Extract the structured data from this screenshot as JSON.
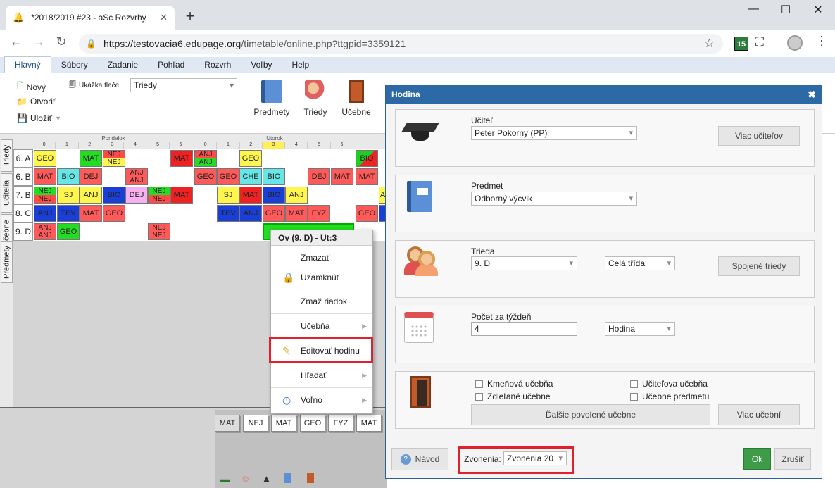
{
  "browser": {
    "tab_title": "*2018/2019 #23 - aSc Rozvrhy",
    "url_host": "https://testovacia6.edupage.org",
    "url_path": "/timetable/online.php?ttgpid=3359121",
    "ext_badge": "15"
  },
  "menu": [
    "Hlavný",
    "Súbory",
    "Zadanie",
    "Pohľad",
    "Rozvrh",
    "Voľby",
    "Help"
  ],
  "ribbon": {
    "new": "Nový",
    "open": "Otvoriť",
    "save": "Uložiť",
    "print_preview": "Ukážka tlače",
    "class_select": "Triedy",
    "big": [
      "Predmety",
      "Triedy",
      "Učebne"
    ]
  },
  "side_tabs": [
    "Triedy",
    "Učitelia",
    "Učebne",
    "Predmety"
  ],
  "timetable": {
    "days": [
      "Pondelok",
      "Utorok"
    ],
    "periods": [
      "0",
      "1",
      "2",
      "3",
      "4",
      "5",
      "6"
    ],
    "rows": [
      "6. A",
      "6. B",
      "7. B",
      "8. C",
      "9. D"
    ]
  },
  "bottom_cards": [
    "MAT",
    "NEJ",
    "MAT",
    "GEO",
    "FYZ",
    "MAT"
  ],
  "context_menu": {
    "header": "Ov (9. D) - Ut:3",
    "items": [
      "Zmazať",
      "Uzamknúť",
      "Zmaž riadok",
      "Učebňa",
      "Editovať hodinu",
      "Hľadať",
      "Voľno"
    ]
  },
  "dialog": {
    "title": "Hodina",
    "teacher_label": "Učiteľ",
    "teacher_value": "Peter Pokorny (PP)",
    "more_teachers": "Viac učiteľov",
    "subject_label": "Predmet",
    "subject_value": "Odborný výcvik",
    "class_label": "Trieda",
    "class_value": "9. D",
    "group_value": "Celá třída",
    "joined_classes": "Spojené triedy",
    "count_label": "Počet za týždeň",
    "count_value": "4",
    "unit_value": "Hodina",
    "checks": [
      "Kmeňová učebňa",
      "Učiteľova učebňa",
      "Zdieľané učebne",
      "Učebne predmetu"
    ],
    "more_rooms_allowed": "Ďalšie povolené učebne",
    "more_rooms": "Viac učební",
    "help": "Návod",
    "bells_label": "Zvonenia:",
    "bells_value": "Zvonenia 20",
    "ok": "Ok",
    "cancel": "Zrušiť"
  }
}
